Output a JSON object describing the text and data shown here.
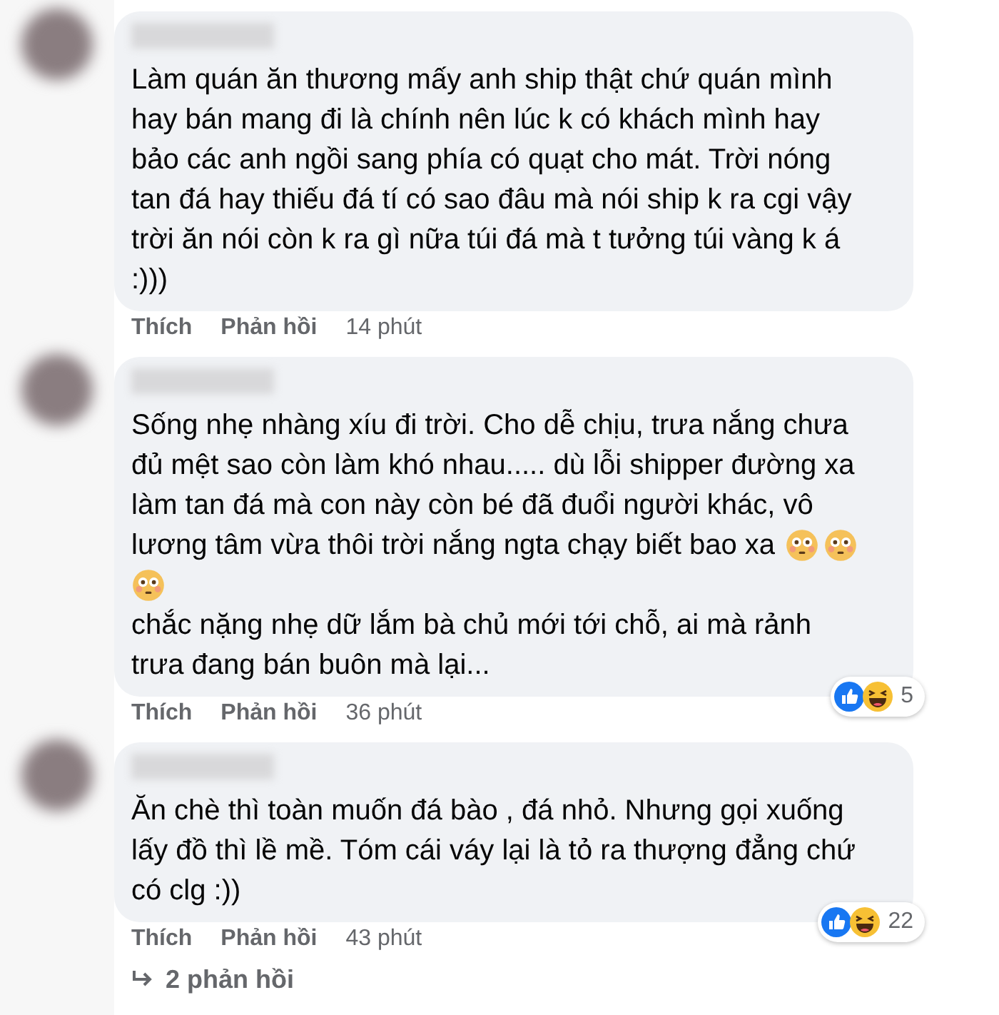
{
  "comments": [
    {
      "lines": [
        [
          {
            "kind": "text",
            "text": "Làm quán ăn thương mấy anh ship thật chứ quán mình"
          }
        ],
        [
          {
            "kind": "text",
            "text": "hay bán mang đi là chính nên lúc k có khách mình hay"
          }
        ],
        [
          {
            "kind": "text",
            "text": "bảo các anh ngồi sang phía có quạt cho mát. Trời nóng"
          }
        ],
        [
          {
            "kind": "text",
            "text": "tan đá hay thiếu đá tí có sao đâu mà nói ship k ra cgi vậy"
          }
        ],
        [
          {
            "kind": "text",
            "text": "trời ăn nói còn k ra gì nữa túi đá mà t tưởng túi vàng k á"
          }
        ],
        [
          {
            "kind": "text",
            "text": ":)))"
          }
        ]
      ],
      "actions": [
        "Thích",
        "Phản hồi"
      ],
      "time": "14 phút"
    },
    {
      "lines": [
        [
          {
            "kind": "text",
            "text": "Sống nhẹ nhàng xíu đi trời. Cho dễ chịu, trưa nắng chưa"
          }
        ],
        [
          {
            "kind": "text",
            "text": "đủ mệt sao còn làm khó nhau..... dù lỗi shipper đường xa"
          }
        ],
        [
          {
            "kind": "text",
            "text": "làm tan đá mà con này còn bé đã đuổi người khác, vô"
          }
        ],
        [
          {
            "kind": "text",
            "text": "lương tâm vừa thôi trời nắng ngta chạy biết bao xa"
          },
          {
            "kind": "emoji"
          },
          {
            "kind": "emoji"
          }
        ],
        [
          {
            "kind": "emoji"
          }
        ],
        [
          {
            "kind": "text",
            "text": "chắc nặng nhẹ dữ lắm bà chủ mới tới chỗ, ai mà rảnh"
          }
        ],
        [
          {
            "kind": "text",
            "text": "trưa đang bán buôn mà lại..."
          }
        ]
      ],
      "actions": [
        "Thích",
        "Phản hồi"
      ],
      "time": "36 phút",
      "reaction_count": "5"
    },
    {
      "lines": [
        [
          {
            "kind": "text",
            "text": "Ăn chè thì toàn muốn đá bào , đá nhỏ. Nhưng gọi xuống"
          }
        ],
        [
          {
            "kind": "text",
            "text": "lấy đồ thì lề mề. Tóm cái váy lại là tỏ ra thượng đẳng chứ"
          }
        ],
        [
          {
            "kind": "text",
            "text": "có clg :))"
          }
        ]
      ],
      "actions": [
        "Thích",
        "Phản hồi"
      ],
      "time": "43 phút",
      "reaction_count": "22",
      "replies": "2 phản hồi"
    }
  ]
}
